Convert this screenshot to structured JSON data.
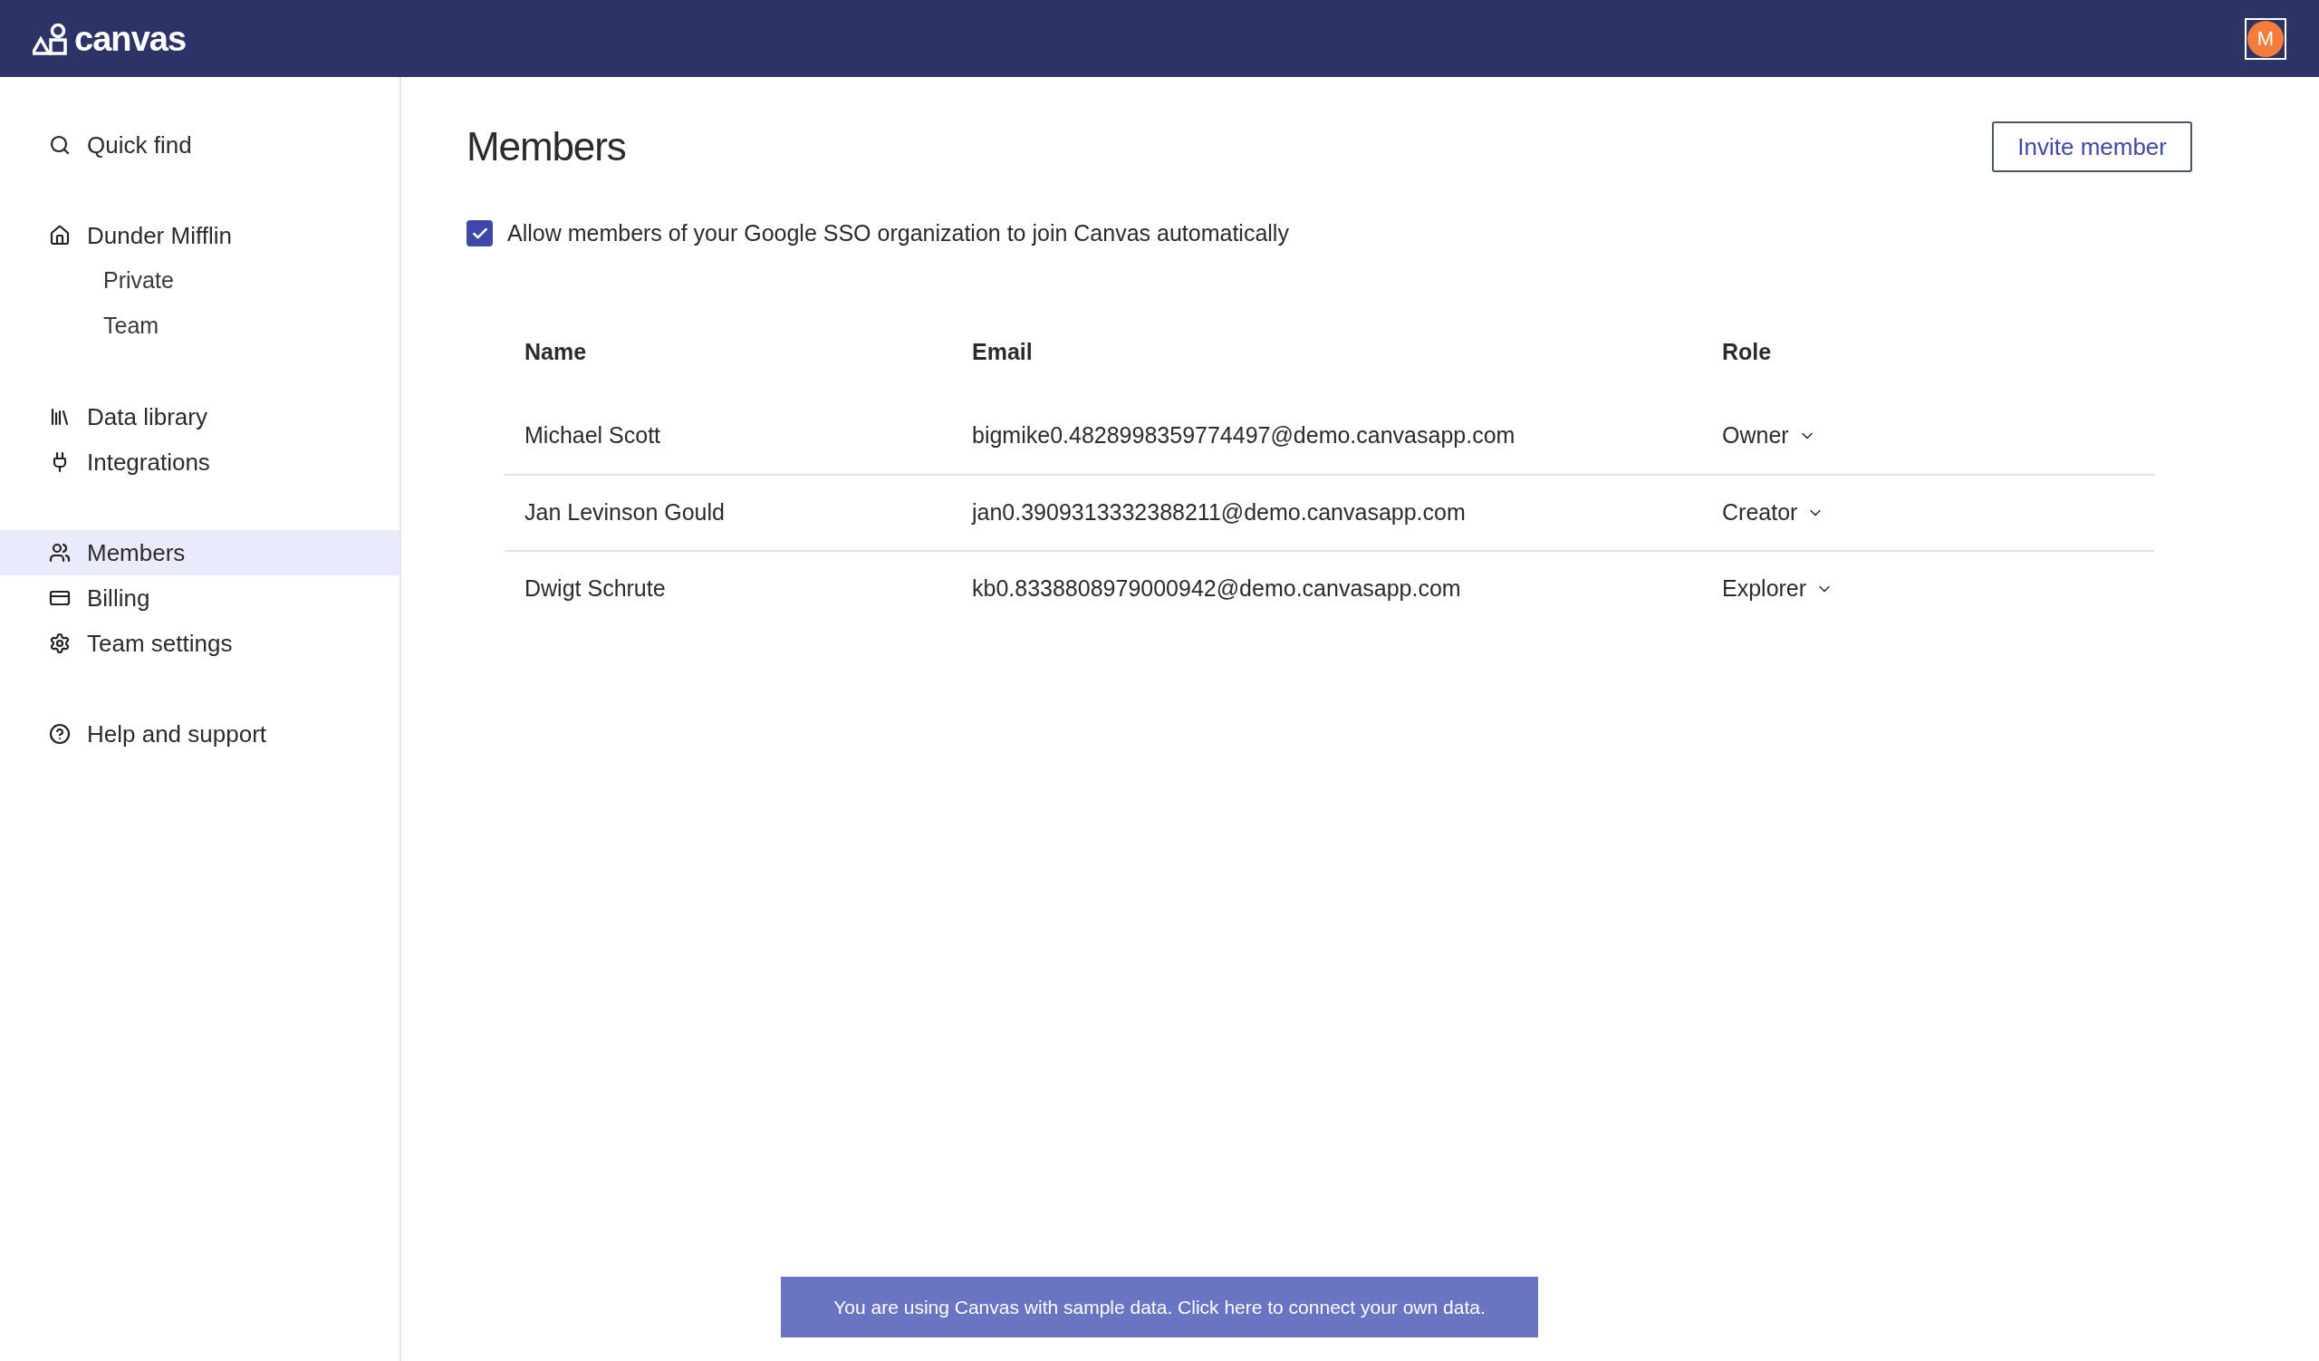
{
  "header": {
    "logo": "canvas",
    "avatar": "M"
  },
  "sidebar": {
    "sections": [
      [
        {
          "label": "Quick find",
          "selected": false
        }
      ],
      [
        {
          "label": "Dunder Mifflin",
          "selected": false,
          "children": [
            {
              "label": "Private",
              "selected": false
            },
            {
              "label": "Team",
              "selected": false
            }
          ]
        }
      ],
      [
        {
          "label": "Data library",
          "selected": false
        },
        {
          "label": "Integrations",
          "selected": false
        }
      ],
      [
        {
          "label": "Members",
          "selected": true
        },
        {
          "label": "Billing",
          "selected": false
        },
        {
          "label": "Team settings",
          "selected": false
        }
      ],
      [
        {
          "label": "Help and support",
          "selected": false
        }
      ]
    ]
  },
  "page": {
    "title": "Members",
    "invite_button": "Invite member",
    "sso_option": {
      "label": "Allow members of your Google SSO organization to join Canvas automatically",
      "checked": true
    }
  },
  "table": {
    "columns": [
      "Name",
      "Email",
      "Role"
    ],
    "rows": [
      {
        "name": "Michael Scott",
        "email": "bigmike0.4828998359774497@demo.canvasapp.com",
        "role": "Owner"
      },
      {
        "name": "Jan Levinson Gould",
        "email": "jan0.3909313332388211@demo.canvasapp.com",
        "role": "Creator"
      },
      {
        "name": "Dwigt Schrute",
        "email": "kb0.8338808979000942@demo.canvasapp.com",
        "role": "Explorer"
      }
    ]
  },
  "banner": "You are using Canvas with sample data. Click here to connect your own data."
}
